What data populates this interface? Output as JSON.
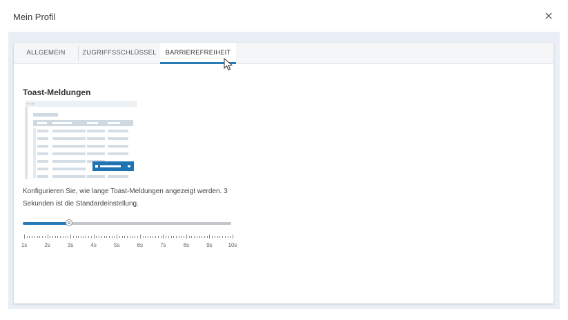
{
  "dialog": {
    "title": "Mein Profil",
    "close_icon": "close-icon"
  },
  "tabs": [
    {
      "label": "ALLGEMEIN",
      "active": false
    },
    {
      "label": "ZUGRIFFSSCHLÜSSEL",
      "active": false
    },
    {
      "label": "BARRIEREFREIHEIT",
      "active": true
    }
  ],
  "accessibility": {
    "section_title": "Toast-Meldungen",
    "description": "Konfigurieren Sie, wie lange Toast-Meldungen angezeigt werden. 3 Sekunden ist die Standardeinstellung.",
    "slider": {
      "value": 3,
      "min": 1,
      "max": 10,
      "unit": "s",
      "labels": [
        "1s",
        "2s",
        "3s",
        "4s",
        "5s",
        "6s",
        "7s",
        "8s",
        "9s",
        "10s"
      ]
    }
  },
  "colors": {
    "accent": "#2a7ab8",
    "panel_background": "#e9eff5",
    "track": "#c3c7cb"
  }
}
